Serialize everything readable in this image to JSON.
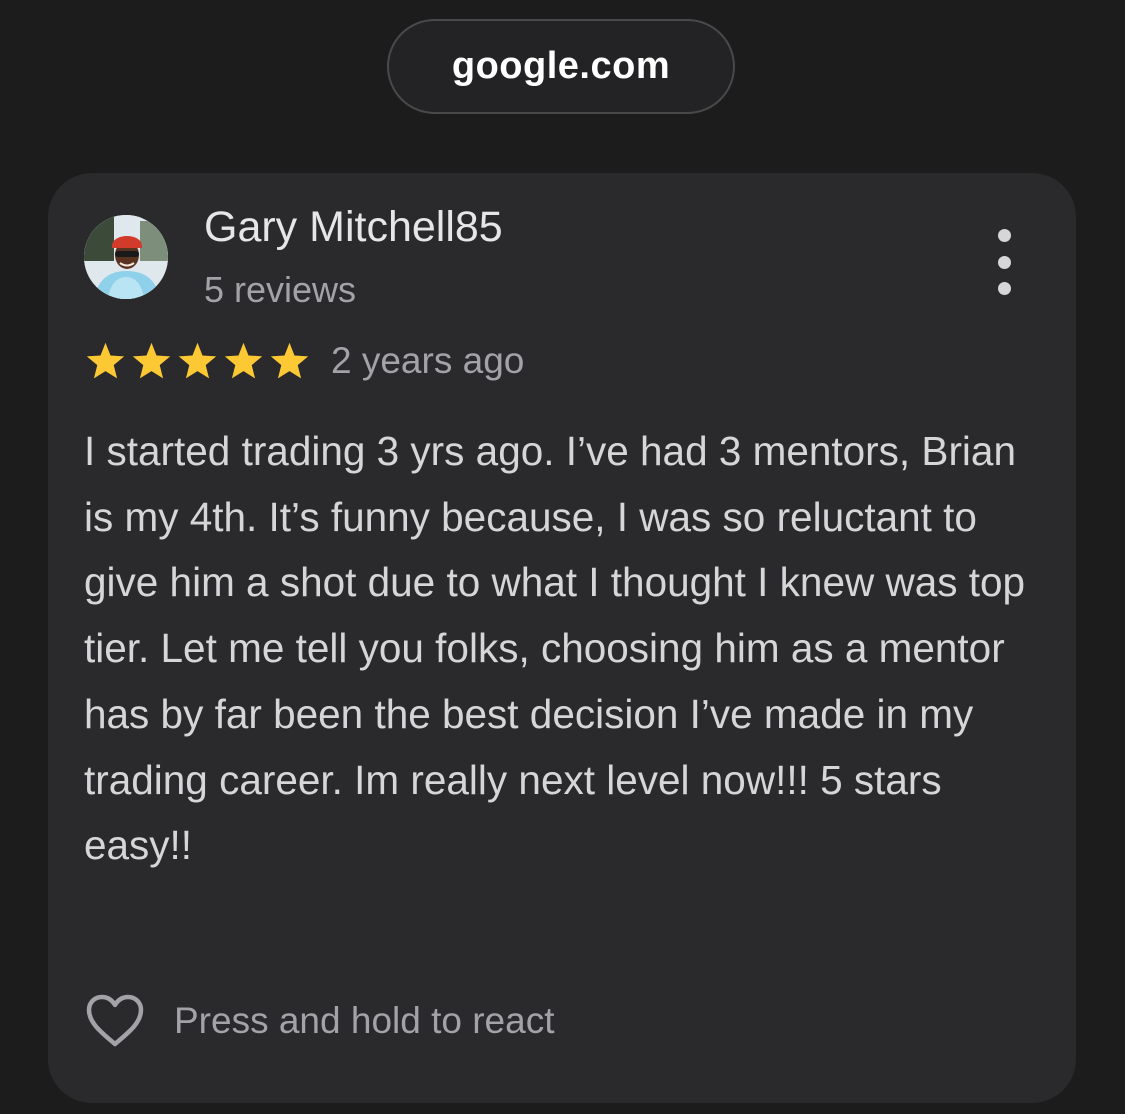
{
  "address_bar": {
    "domain": "google.com"
  },
  "review": {
    "author": {
      "name": "Gary Mitchell85",
      "reviews_count": "5 reviews",
      "avatar_icon": "profile-photo"
    },
    "rating": {
      "stars": 5,
      "max_stars": 5,
      "star_color": "#fcc934"
    },
    "date": "2 years ago",
    "text": "I started trading 3 yrs ago. I’ve had 3 mentors, Brian is my 4th. It’s funny because, I was so reluctant to give him a shot due to what I thought I knew was top tier. Let me tell you folks, choosing him as a mentor has by far been the best decision I’ve made in my trading career. Im really next level now!!! 5 stars easy!!",
    "react_label": "Press and hold to react",
    "more_icon": "more-vertical-icon",
    "react_icon": "heart-outline-icon"
  },
  "colors": {
    "background": "#1c1c1d",
    "card": "#2a2a2c",
    "primary_text": "#e6e6e8",
    "secondary_text": "#a3a3a7"
  }
}
